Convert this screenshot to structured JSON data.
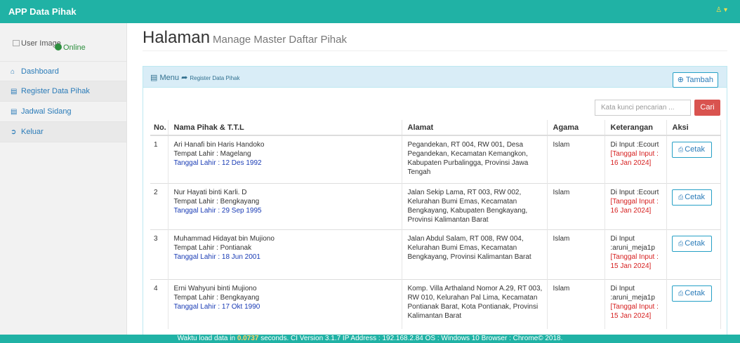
{
  "app": {
    "brand": "APP Data Pihak",
    "user_icon": "user-icon",
    "user_caret": "▾"
  },
  "sidebar": {
    "user_image_alt": "User Image",
    "status": "Online",
    "items": [
      {
        "icon": "home-icon",
        "label": "Dashboard"
      },
      {
        "icon": "list-icon",
        "label": "Register Data Pihak"
      },
      {
        "icon": "list-icon",
        "label": "Jadwal Sidang"
      },
      {
        "icon": "logout-icon",
        "label": "Keluar"
      }
    ]
  },
  "page": {
    "title": "Halaman",
    "subtitle": "Manage Master Daftar Pihak"
  },
  "panel": {
    "menu_label": "Menu",
    "crumb": "Register Data Pihak",
    "add_button": "Tambah",
    "search_placeholder": "Kata kunci pencarian ...",
    "search_button": "Cari"
  },
  "table": {
    "headers": [
      "No.",
      "Nama Pihak & T.T.L",
      "Alamat",
      "Agama",
      "Keterangan",
      "Aksi"
    ],
    "print_label": "Cetak",
    "rows": [
      {
        "no": "1",
        "nama": "Ari Hanafi bin Haris Handoko",
        "tempat": "Tempat Lahir : Magelang",
        "tanggal": "Tanggal Lahir : 12 Des 1992",
        "alamat": "Pegandekan, RT 004, RW 001, Desa Pegandekan, Kecamatan Kemangkon, Kabupaten Purbalingga, Provinsi Jawa Tengah",
        "agama": "Islam",
        "ket": "Di Input :Ecourt",
        "ket_tgl": "[Tanggal Input : 16 Jan 2024]"
      },
      {
        "no": "2",
        "nama": "Nur Hayati binti Karli. D",
        "tempat": "Tempat Lahir : Bengkayang",
        "tanggal": "Tanggal Lahir : 29 Sep 1995",
        "alamat": "Jalan Sekip Lama, RT 003, RW 002, Kelurahan Bumi Emas, Kecamatan Bengkayang, Kabupaten Bengkayang, Provinsi Kalimantan Barat",
        "agama": "Islam",
        "ket": "Di Input :Ecourt",
        "ket_tgl": "[Tanggal Input : 16 Jan 2024]"
      },
      {
        "no": "3",
        "nama": "Muhammad Hidayat bin Mujiono",
        "tempat": "Tempat Lahir : Pontianak",
        "tanggal": "Tanggal Lahir : 18 Jun 2001",
        "alamat": "Jalan Abdul Salam, RT 008, RW 004, Kelurahan Bumi Emas, Kecamatan Bengkayang, Provinsi Kalimantan Barat",
        "agama": "Islam",
        "ket": "Di Input :aruni_meja1p",
        "ket_tgl": "[Tanggal Input : 15 Jan 2024]"
      },
      {
        "no": "4",
        "nama": "Erni Wahyuni binti Mujiono",
        "tempat": "Tempat Lahir : Bengkayang",
        "tanggal": "Tanggal Lahir : 17 Okt 1990",
        "alamat": "Komp. Villa Arthaland Nomor A.29, RT 003, RW 010, Kelurahan Pal Lima, Kecamatan Pontianak Barat, Kota Pontianak, Provinsi Kalimantan Barat",
        "agama": "Islam",
        "ket": "Di Input :aruni_meja1p",
        "ket_tgl": "[Tanggal Input : 15 Jan 2024]"
      }
    ]
  },
  "footer": {
    "pre": "Waktu load data in ",
    "time": "0.0737",
    "post": " seconds. CI Version 3.1.7 IP Address : 192.168.2.84 OS : Windows 10 Browser : Chrome© 2018."
  },
  "colors": {
    "topbar": "#20b2a5",
    "link": "#2a7bb8",
    "danger": "#d9534f"
  }
}
